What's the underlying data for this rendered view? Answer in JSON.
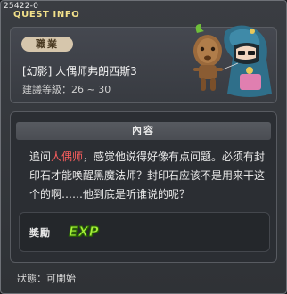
{
  "window": {
    "quest_id": "25422-0",
    "title": "QUEST INFO"
  },
  "header": {
    "job_label": "職業",
    "quest_name": "[幻影] 人偶师弗朗西斯3",
    "recommended_level": "建議等級：26 ~ 30"
  },
  "content": {
    "heading": "內容",
    "text_before": "追问",
    "text_highlight": "人偶师",
    "text_after": "，感觉他说得好像有点问题。必须有封印石才能唤醒黑魔法师？封印石应该不是用来干这个的啊……他到底是听谁说的呢？",
    "highlight_color": "#ff5f5f"
  },
  "reward": {
    "label": "獎勵",
    "exp_text": "EXP",
    "exp_color": "#a8f03a"
  },
  "status": {
    "text": "狀態：可開始"
  },
  "npc": {
    "icon": "puppeteer-npc-with-wooden-doll"
  }
}
